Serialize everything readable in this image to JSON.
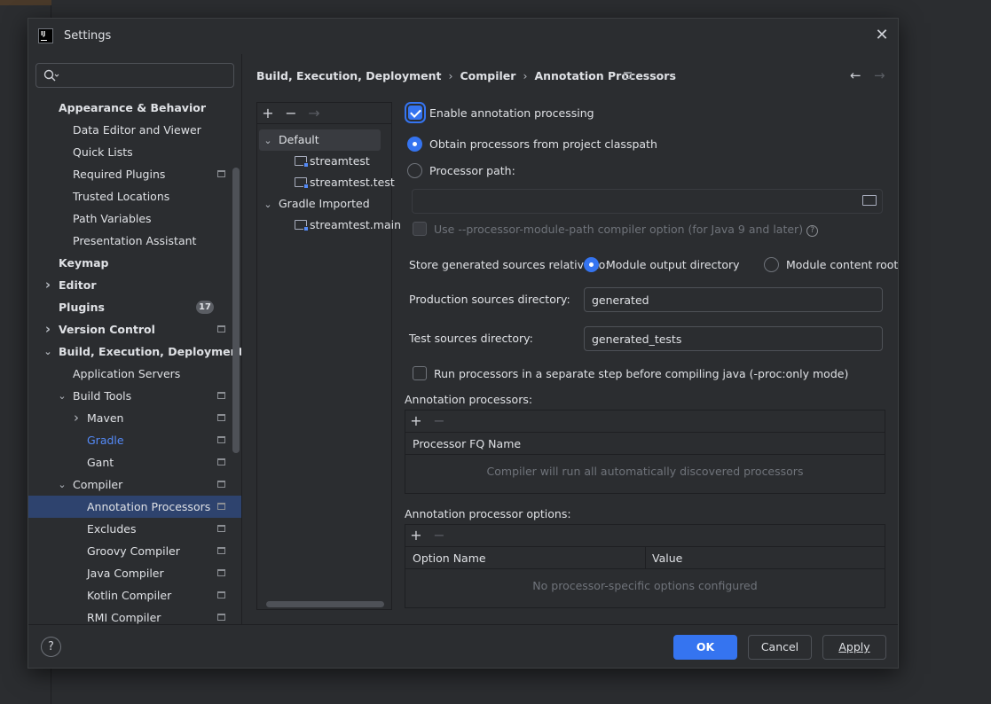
{
  "window": {
    "title": "Settings"
  },
  "search": {
    "placeholder": ""
  },
  "sidebar": {
    "items": [
      {
        "label": "Appearance & Behavior",
        "level": 0,
        "bold": true,
        "chevron": ""
      },
      {
        "label": "Data Editor and Viewer",
        "level": 1,
        "chevron": ""
      },
      {
        "label": "Quick Lists",
        "level": 1,
        "chevron": ""
      },
      {
        "label": "Required Plugins",
        "level": 1,
        "chevron": "",
        "project": true
      },
      {
        "label": "Trusted Locations",
        "level": 1,
        "chevron": ""
      },
      {
        "label": "Path Variables",
        "level": 1,
        "chevron": ""
      },
      {
        "label": "Presentation Assistant",
        "level": 1,
        "chevron": ""
      },
      {
        "label": "Keymap",
        "level": 0,
        "bold": true,
        "chevron": ""
      },
      {
        "label": "Editor",
        "level": 0,
        "bold": true,
        "chevron": "right"
      },
      {
        "label": "Plugins",
        "level": 0,
        "bold": true,
        "chevron": "",
        "badge": "17"
      },
      {
        "label": "Version Control",
        "level": 0,
        "bold": true,
        "chevron": "right",
        "project": true
      },
      {
        "label": "Build, Execution, Deployment",
        "level": 0,
        "bold": true,
        "chevron": "down"
      },
      {
        "label": "Application Servers",
        "level": 1,
        "chevron": ""
      },
      {
        "label": "Build Tools",
        "level": 1,
        "chevron": "down",
        "project": true
      },
      {
        "label": "Maven",
        "level": 2,
        "chevron": "right",
        "project": true
      },
      {
        "label": "Gradle",
        "level": 2,
        "chevron": "",
        "project": true,
        "link": true
      },
      {
        "label": "Gant",
        "level": 2,
        "chevron": "",
        "project": true
      },
      {
        "label": "Compiler",
        "level": 1,
        "chevron": "down",
        "project": true
      },
      {
        "label": "Annotation Processors",
        "level": 2,
        "chevron": "",
        "project": true,
        "selected": true
      },
      {
        "label": "Excludes",
        "level": 2,
        "chevron": "",
        "project": true
      },
      {
        "label": "Groovy Compiler",
        "level": 2,
        "chevron": "",
        "project": true
      },
      {
        "label": "Java Compiler",
        "level": 2,
        "chevron": "",
        "project": true
      },
      {
        "label": "Kotlin Compiler",
        "level": 2,
        "chevron": "",
        "project": true
      },
      {
        "label": "RMI Compiler",
        "level": 2,
        "chevron": "",
        "project": true
      }
    ]
  },
  "breadcrumb": [
    "Build, Execution, Deployment",
    "Compiler",
    "Annotation Processors"
  ],
  "profiles": {
    "default": "Default",
    "default_children": [
      "streamtest",
      "streamtest.test"
    ],
    "gradle": "Gradle Imported",
    "gradle_children": [
      "streamtest.main"
    ]
  },
  "form": {
    "enable_label": "Enable annotation processing",
    "obtain_label": "Obtain processors from project classpath",
    "processor_path_label": "Processor path:",
    "processor_path_value": "",
    "module_path_label": "Use --processor-module-path compiler option (for Java 9 and later)",
    "store_label": "Store generated sources relative to:",
    "module_output_label": "Module output directory",
    "module_content_label": "Module content root",
    "production_label": "Production sources directory:",
    "production_value": "generated",
    "test_label": "Test sources directory:",
    "test_value": "generated_tests",
    "run_separate_label": "Run processors in a separate step before compiling java (-proc:only mode)"
  },
  "processors_table": {
    "title": "Annotation processors:",
    "column": "Processor FQ Name",
    "empty": "Compiler will run all automatically discovered processors"
  },
  "options_table": {
    "title": "Annotation processor options:",
    "col_name": "Option Name",
    "col_value": "Value",
    "empty": "No processor-specific options configured"
  },
  "buttons": {
    "ok": "OK",
    "cancel": "Cancel",
    "apply": "Apply"
  },
  "colors": {
    "accent": "#3574f0",
    "selection": "#2e436e",
    "link": "#548af7"
  }
}
